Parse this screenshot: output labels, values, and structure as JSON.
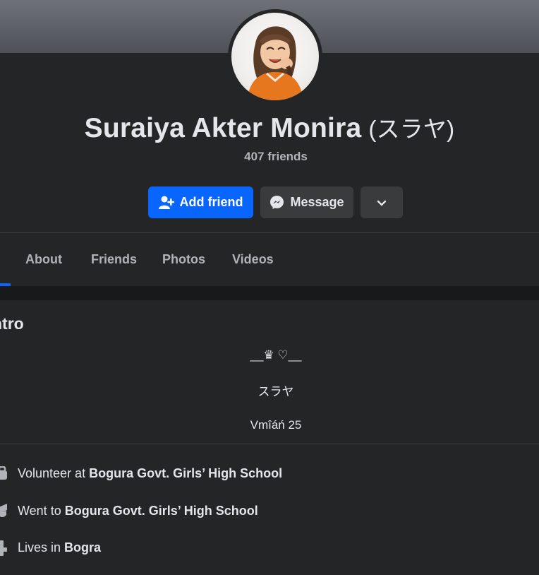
{
  "profile": {
    "name": "Suraiya Akter Monira",
    "alternate_name": "(スラヤ)",
    "friends_count": "407 friends"
  },
  "actions": {
    "add_friend_label": "Add friend",
    "message_label": "Message"
  },
  "tabs": [
    {
      "label": "About"
    },
    {
      "label": "Friends"
    },
    {
      "label": "Photos"
    },
    {
      "label": "Videos"
    }
  ],
  "intro": {
    "title": "ntro",
    "bio_lines": [
      "__♛ ♡__",
      "スラヤ",
      "Vmîáń 25"
    ],
    "details": [
      {
        "prefix": "Volunteer at ",
        "value": "Bogura Govt. Girls’ High School",
        "icon": "briefcase-icon"
      },
      {
        "prefix": "Went to ",
        "value": "Bogura Govt. Girls’ High School",
        "icon": "graduation-cap-icon"
      },
      {
        "prefix": "Lives in ",
        "value": "Bogra",
        "icon": "home-icon"
      }
    ]
  },
  "colors": {
    "accent": "#0866ff",
    "background": "#242526",
    "secondary_button": "#3a3b3c"
  }
}
